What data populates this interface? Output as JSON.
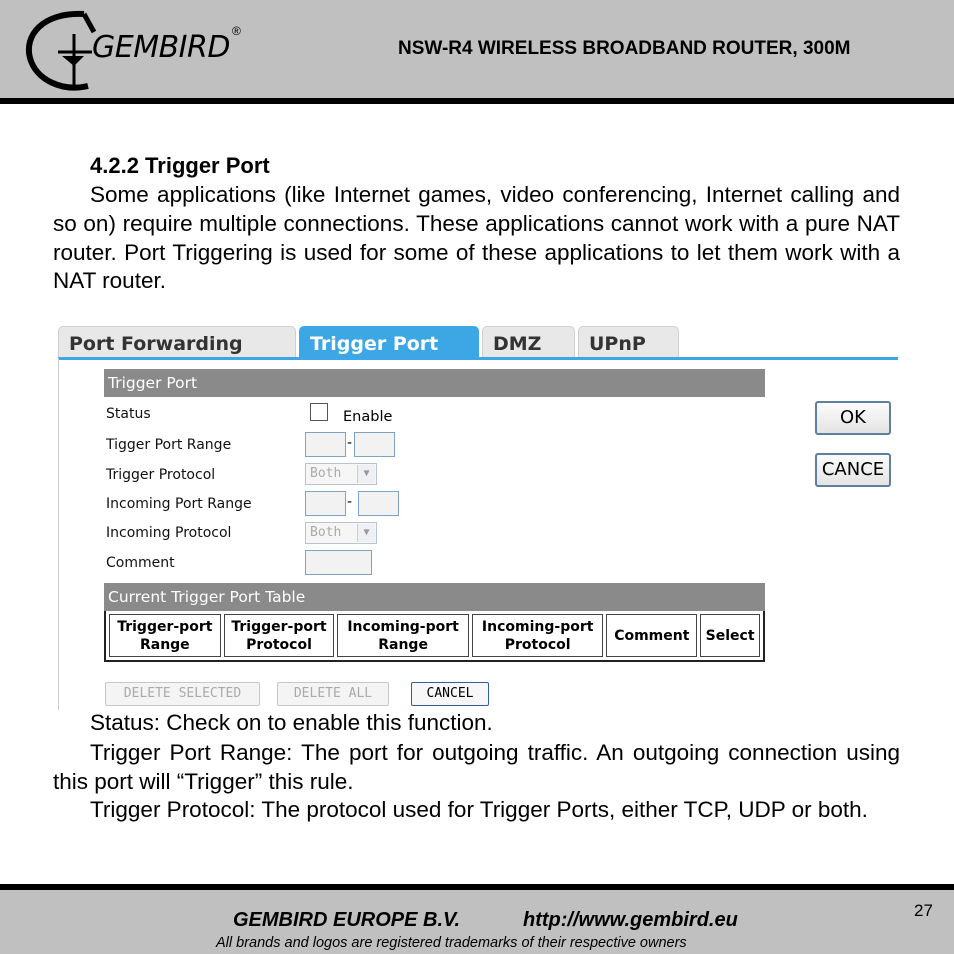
{
  "header": {
    "logo_text": "GEMBIRD",
    "logo_mark": "®",
    "doc_title": "NSW-R4 WIRELESS BROADBAND ROUTER, 300M"
  },
  "section": {
    "heading": "4.2.2 Trigger Port",
    "intro": "Some applications (like Internet games, video conferencing, Internet calling and so on) require multiple connections. These applications cannot work with a pure NAT router. Port Triggering is used for some of these applications to let them work with a NAT router."
  },
  "screenshot": {
    "tabs": [
      "Port Forwarding",
      "Trigger Port",
      "DMZ",
      "UPnP"
    ],
    "active_tab": "Trigger Port",
    "form_header": "Trigger Port",
    "labels": {
      "status": "Status",
      "trigger_range": "Tigger Port Range",
      "trigger_protocol": "Trigger Protocol",
      "incoming_range": "Incoming Port Range",
      "incoming_protocol": "Incoming Protocol",
      "comment": "Comment"
    },
    "enable_label": "Enable",
    "range_separator": "-",
    "trigger_protocol_value": "Both",
    "incoming_protocol_value": "Both",
    "ok_label": "OK",
    "cancel_label": "CANCE",
    "table_header": "Current Trigger Port Table",
    "columns": [
      "Trigger-port Range",
      "Trigger-port Protocol",
      "Incoming-port Range",
      "Incoming-port Protocol",
      "Comment",
      "Select"
    ],
    "delete_selected_label": "DELETE SELECTED",
    "delete_all_label": "DELETE ALL",
    "bottom_cancel_label": "CANCEL",
    "colors": {
      "tab_active": "#3da7e6",
      "section_header": "#8a8a8a"
    }
  },
  "descriptions": {
    "status": "Status: Check on to enable this function.",
    "trigger_range": "Trigger Port Range: The port for outgoing traffic. An outgoing connection using this port will “Trigger” this rule.",
    "trigger_protocol": "Trigger Protocol: The protocol used for Trigger Ports, either TCP, UDP or both."
  },
  "footer": {
    "company": "GEMBIRD EUROPE B.V.",
    "url": "http://www.gembird.eu",
    "note": "All brands and logos are registered trademarks of their respective owners",
    "page_number": "27"
  }
}
